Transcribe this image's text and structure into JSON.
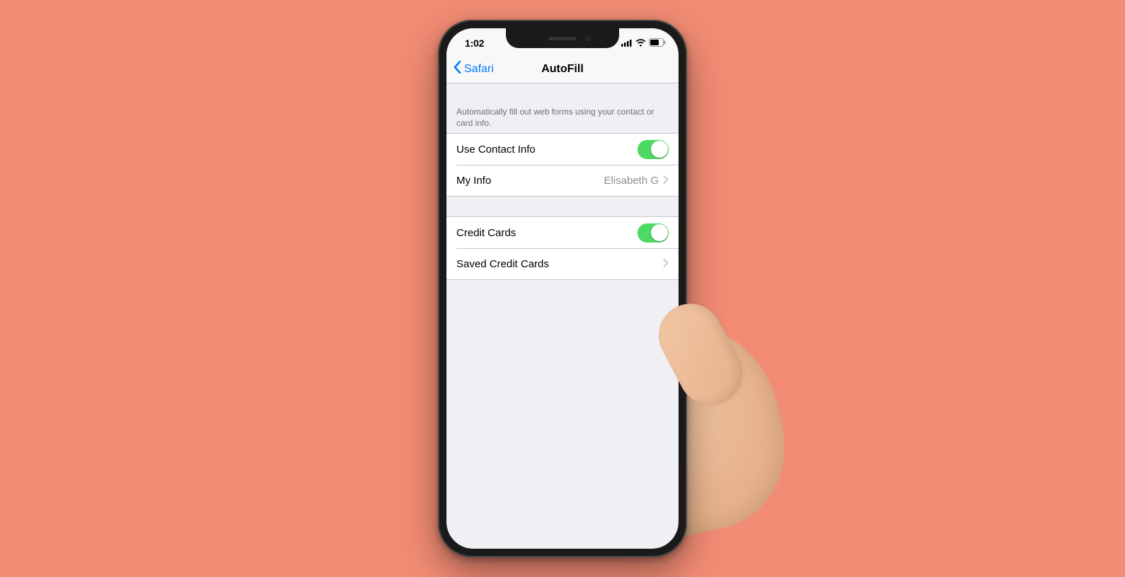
{
  "statusbar": {
    "time": "1:02"
  },
  "nav": {
    "back_label": "Safari",
    "title": "AutoFill"
  },
  "section1": {
    "header": "Automatically fill out web forms using your contact or card info.",
    "use_contact_label": "Use Contact Info",
    "my_info_label": "My Info",
    "my_info_value": "Elisabeth G"
  },
  "section2": {
    "credit_cards_label": "Credit Cards",
    "saved_cards_label": "Saved Credit Cards"
  }
}
